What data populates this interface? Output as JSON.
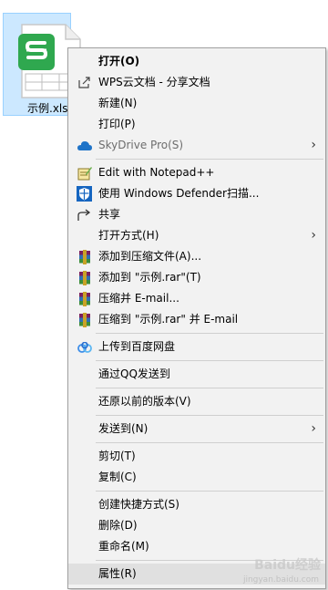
{
  "file": {
    "name": "示例.xlsx",
    "label_visible": "示例.xls",
    "icon": "wps-spreadsheet-icon",
    "brand_color": "#2fa84f"
  },
  "menu": {
    "items": [
      {
        "label": "打开(O)",
        "bold": true
      },
      {
        "label": "WPS云文档 - 分享文档",
        "icon": "share-cloud-icon"
      },
      {
        "label": "新建(N)"
      },
      {
        "label": "打印(P)"
      },
      {
        "label": "SkyDrive Pro(S)",
        "icon": "cloud-icon",
        "disabled": true,
        "submenu": true
      },
      {
        "label": "Edit with Notepad++",
        "icon": "notepad-plus-icon"
      },
      {
        "label": "使用 Windows Defender扫描...",
        "icon": "defender-shield-icon"
      },
      {
        "label": "共享",
        "icon": "share-icon"
      },
      {
        "label": "打开方式(H)",
        "submenu": true
      },
      {
        "label": "添加到压缩文件(A)...",
        "icon": "winrar-icon"
      },
      {
        "label": "添加到 \"示例.rar\"(T)",
        "icon": "winrar-icon"
      },
      {
        "label": "压缩并 E-mail...",
        "icon": "winrar-icon"
      },
      {
        "label": "压缩到 \"示例.rar\" 并 E-mail",
        "icon": "winrar-icon"
      },
      {
        "label": "上传到百度网盘",
        "icon": "baidu-netdisk-icon"
      },
      {
        "label": "通过QQ发送到"
      },
      {
        "label": "还原以前的版本(V)"
      },
      {
        "label": "发送到(N)",
        "submenu": true
      },
      {
        "label": "剪切(T)"
      },
      {
        "label": "复制(C)"
      },
      {
        "label": "创建快捷方式(S)"
      },
      {
        "label": "删除(D)"
      },
      {
        "label": "重命名(M)"
      },
      {
        "label": "属性(R)",
        "highlighted": true
      }
    ],
    "submenu_arrow": "›"
  },
  "watermark": {
    "text": "Baidu经验",
    "sub": "jingyan.baidu.com"
  }
}
